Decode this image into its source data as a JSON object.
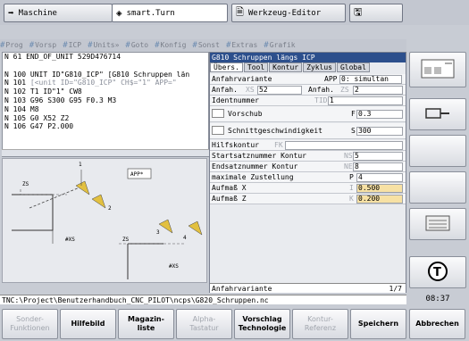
{
  "tabs": [
    {
      "label": "Maschine",
      "icon": "arrow-right-icon"
    },
    {
      "label": "smart.Turn",
      "icon": "diamond-icon"
    },
    {
      "label": "Werkzeug-Editor",
      "icon": "document-icon"
    },
    {
      "label": "",
      "icon": "save-icon"
    }
  ],
  "menu": [
    "Prog",
    "Vorsp",
    "ICP",
    "Units»",
    "Goto",
    "Konfig",
    "Sonst",
    "Extras",
    "Grafik"
  ],
  "nc_lines": [
    {
      "num": "N  61",
      "text": "END_OF_UNIT 529D476714"
    },
    {
      "num": "",
      "text": ""
    },
    {
      "num": "N 100",
      "text": "UNIT ID\"G810_ICP\" [G810 Schruppen län"
    },
    {
      "num": "N 101",
      "text": "  [<unit ID=\"G810_ICP\" CH$=\"1\" APP=\""
    },
    {
      "num": "N 102",
      "text": "T1 ID\"1\" CW8"
    },
    {
      "num": "N 103",
      "text": "G96 S300 G95 F0.3 M3"
    },
    {
      "num": "N 104",
      "text": "M8"
    },
    {
      "num": "N 105",
      "text": "G0 X52 Z2"
    },
    {
      "num": "N 106",
      "text": "G47 P2.000"
    }
  ],
  "graphic_labels": {
    "app": "APP*",
    "zs1": "ZS",
    "xs1": "XS",
    "n1": "1",
    "n2": "2",
    "n3": "3",
    "n4": "4",
    "zs2": "ZS",
    "xs2": "XS",
    "xks1": "#XS",
    "xks2": "#XS"
  },
  "dialog": {
    "title": "G810 Schruppen längs ICP",
    "tabs": [
      "Übers.",
      "Tool",
      "Kontur",
      "Zyklus",
      "Global"
    ],
    "rows": [
      {
        "label": "Anfahrvariante",
        "sub": "APP",
        "value": "0: simultan"
      },
      {
        "label": "Anfah.",
        "sub": "XS",
        "value": "52",
        "label2": "Anfah.",
        "sub2": "ZS",
        "value2": "2"
      },
      {
        "label": "Identnummer",
        "sub": "TID",
        "value": "1"
      },
      {
        "label": "Vorschub",
        "sub": "F",
        "value": "0.3"
      },
      {
        "label": "Schnittgeschwindigkeit",
        "sub": "S",
        "value": "300"
      },
      {
        "label": "Hilfskontur",
        "sub": "FK",
        "value": ""
      },
      {
        "label": "Startsatznummer Kontur",
        "sub": "NS",
        "value": "5"
      },
      {
        "label": "Endsatznummer Kontur",
        "sub": "NE",
        "value": "8"
      },
      {
        "label": "maximale Zustellung",
        "sub": "P",
        "value": "4"
      },
      {
        "label": "Aufmaß X",
        "sub": "I",
        "value": "0.500"
      },
      {
        "label": "Aufmaß Z",
        "sub": "K",
        "value": "0.200"
      }
    ],
    "status": "Anfahrvariante",
    "page": "1/7"
  },
  "path": "TNC:\\Project\\Benutzerhandbuch_CNC_PILOT\\ncps\\G820_Schruppen.nc",
  "clock": "08:37",
  "softkeys": [
    {
      "label": "Sonder-\nFunktionen",
      "enabled": false
    },
    {
      "label": "Hilfebild",
      "enabled": true
    },
    {
      "label": "Magazin-\nliste",
      "enabled": true
    },
    {
      "label": "Alpha-\nTastatur",
      "enabled": false
    },
    {
      "label": "Vorschlag\nTechnologie",
      "enabled": true
    },
    {
      "label": "Kontur-\nReferenz",
      "enabled": false
    },
    {
      "label": "Speichern",
      "enabled": true
    },
    {
      "label": "Abbrechen",
      "enabled": true
    }
  ]
}
